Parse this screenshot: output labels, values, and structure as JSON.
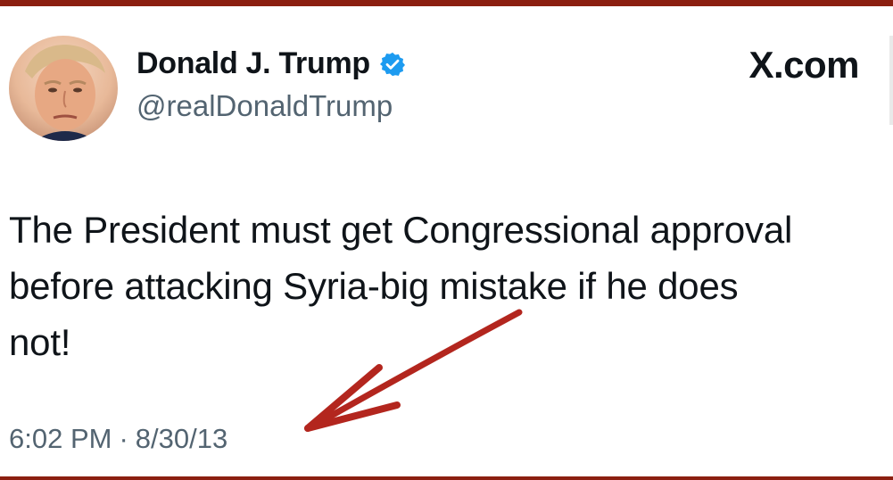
{
  "author": {
    "display_name": "Donald J. Trump",
    "handle": "@realDonaldTrump",
    "verified_icon": "verified-badge-icon",
    "verified_color": "#1d9bf0",
    "avatar_icon": "profile-photo"
  },
  "brand": "X.com",
  "tweet": {
    "lines": [
      "The President must get Congressional approval",
      "before attacking Syria-big mistake if he does",
      "not!"
    ]
  },
  "meta": {
    "time": "6:02 PM",
    "separator": "·",
    "date": "8/30/13"
  },
  "annotation": {
    "arrow_icon": "red-arrow-icon",
    "color": "#b3261e"
  }
}
